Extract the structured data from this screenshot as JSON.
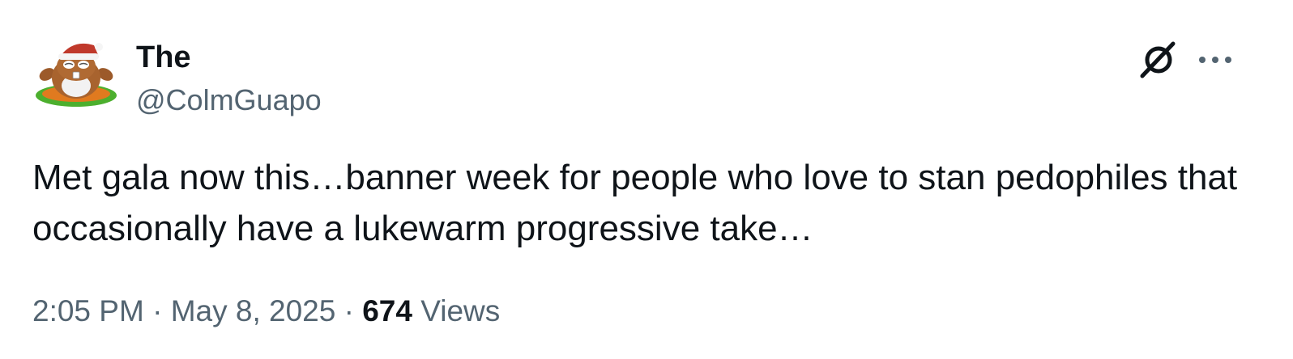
{
  "author": {
    "display_name": "The",
    "handle": "@ColmGuapo",
    "avatar_icon": "cartoon-groundhog-santa-hat-avatar"
  },
  "actions": {
    "grok_icon": "grok-slash-circle-icon",
    "more_icon": "more-dots-icon"
  },
  "tweet": {
    "text": "Met gala now this…banner week for people who love to stan pedophiles that occasionally have a lukewarm progressive take…"
  },
  "meta": {
    "time": "2:05 PM",
    "separator": "·",
    "date": "May 8, 2025",
    "view_count": "674",
    "views_label": "Views"
  },
  "colors": {
    "primary_text": "#0f1419",
    "secondary_text": "#536471",
    "background": "#ffffff"
  }
}
